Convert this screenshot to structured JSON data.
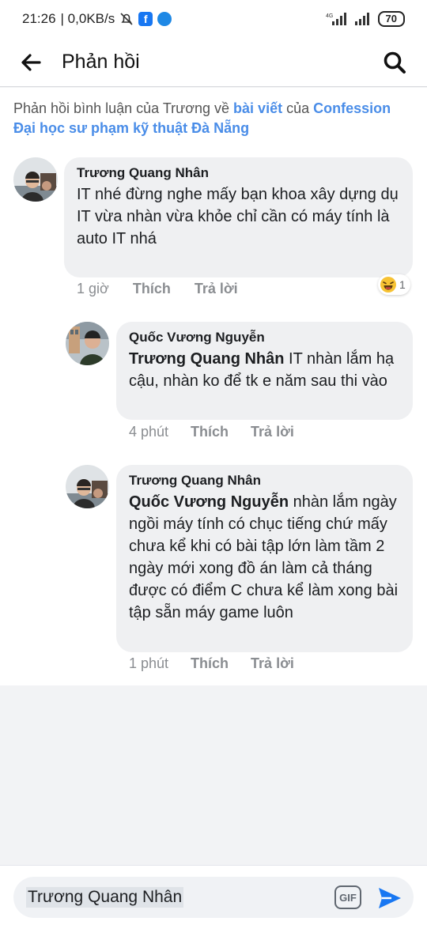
{
  "status_bar": {
    "time": "21:26",
    "network_speed": "| 0,0KB/s",
    "network_type": "4G",
    "battery": "70"
  },
  "app_bar": {
    "title": "Phản hồi"
  },
  "context": {
    "prefix": "Phản hồi bình luận của Trương về ",
    "link_post": "bài viết",
    "middle": " của ",
    "link_page": "Confession Đại học sư phạm kỹ thuật Đà Nẵng"
  },
  "comments": [
    {
      "author": "Trương Quang Nhân",
      "mention": "",
      "text": "IT nhé đừng nghe mấy bạn khoa xây dựng dụ\nIT vừa nhàn vừa khỏe chỉ cần có máy tính là auto IT nhá",
      "time": "1 giờ",
      "like": "Thích",
      "reply": "Trả lời",
      "reaction_count": "1"
    },
    {
      "author": "Quốc Vương Nguyễn",
      "mention": "Trương Quang Nhân",
      "text": " IT nhàn lắm hạ cậu, nhàn ko để tk e năm sau thi vào",
      "time": "4 phút",
      "like": "Thích",
      "reply": "Trả lời"
    },
    {
      "author": "Trương Quang Nhân",
      "mention": "Quốc Vương Nguyễn",
      "text": " nhàn lắm ngày ngồi máy tính có chục tiếng chứ mấy chưa kể khi có bài tập lớn làm tầm 2 ngày mới xong đồ án làm cả tháng được có điểm C chưa kể làm xong bài tập sẵn máy game luôn",
      "time": "1 phút",
      "like": "Thích",
      "reply": "Trả lời"
    }
  ],
  "composer": {
    "value": "Trương Quang Nhân",
    "gif_label": "GIF"
  },
  "colors": {
    "link": "#4a8de8",
    "send": "#1877f2",
    "bubble": "#eff0f2"
  },
  "icons": [
    "back-arrow-icon",
    "search-icon",
    "gif-icon",
    "send-icon",
    "haha-reaction-icon"
  ]
}
